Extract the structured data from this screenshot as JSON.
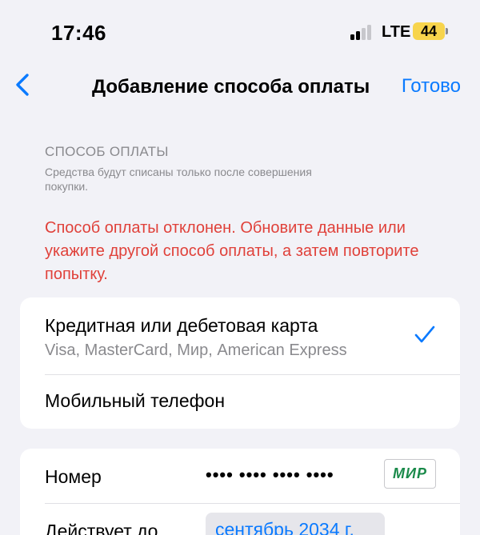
{
  "colors": {
    "accent": "#0a7aff",
    "error": "#e0413a",
    "secondary": "#8a8a8e",
    "battery": "#f7d44c",
    "expiry_bg": "#e6e6eb",
    "signal_dim": "#c7c7cc",
    "mir_green": "#1a8a4a"
  },
  "status_bar": {
    "time": "17:46",
    "network": "LTE",
    "battery_level": "44",
    "signal_bars_active": 2,
    "signal_bars_total": 4
  },
  "nav": {
    "back_icon": "chevron-left-icon",
    "title": "Добавление способа оплаты",
    "done_label": "Готово"
  },
  "payment_section": {
    "header": "СПОСОБ ОПЛАТЫ",
    "subtitle": "Средства будут списаны только после совершения покупки.",
    "error_message": "Способ оплаты отклонен. Обновите данные или укажите другой способ оплаты, а затем повторите попытку."
  },
  "payment_options": [
    {
      "title": "Кредитная или дебетовая карта",
      "subtitle": "Visa, MasterCard, Мир, American Express",
      "selected": true,
      "check_icon": "checkmark-icon"
    },
    {
      "title": "Мобильный телефон",
      "selected": false
    }
  ],
  "card_fields": {
    "number_label": "Номер",
    "number_value": "•••• •••• •••• ••••",
    "card_brand": "МИР",
    "expiry_label": "Действует до",
    "expiry_value": "сентябрь 2034 г."
  }
}
